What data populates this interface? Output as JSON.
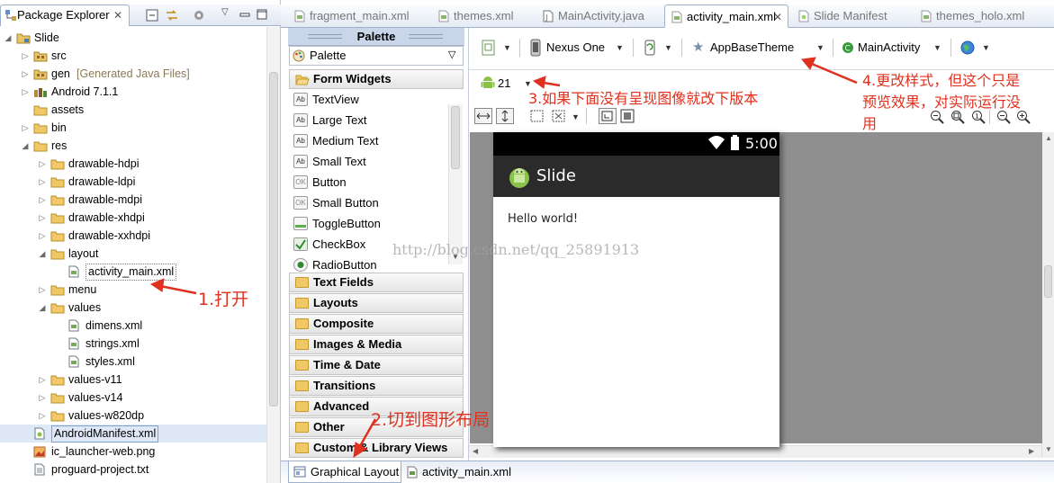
{
  "package_explorer": {
    "tab_label": "Package Explorer",
    "tree": [
      {
        "label": "Slide",
        "icon": "project-icon"
      },
      {
        "label": "src",
        "icon": "package-folder-icon"
      },
      {
        "label": "gen",
        "extra": "[Generated Java Files]",
        "icon": "package-folder-icon"
      },
      {
        "label": "Android 7.1.1",
        "icon": "library-icon"
      },
      {
        "label": "assets",
        "icon": "folder-icon"
      },
      {
        "label": "bin",
        "icon": "folder-icon"
      },
      {
        "label": "res",
        "icon": "folder-icon"
      },
      {
        "label": "drawable-hdpi",
        "icon": "folder-icon"
      },
      {
        "label": "drawable-ldpi",
        "icon": "folder-icon"
      },
      {
        "label": "drawable-mdpi",
        "icon": "folder-icon"
      },
      {
        "label": "drawable-xhdpi",
        "icon": "folder-icon"
      },
      {
        "label": "drawable-xxhdpi",
        "icon": "folder-icon"
      },
      {
        "label": "layout",
        "icon": "folder-icon"
      },
      {
        "label": "activity_main.xml",
        "icon": "xml-file-icon"
      },
      {
        "label": "menu",
        "icon": "folder-icon"
      },
      {
        "label": "values",
        "icon": "folder-icon"
      },
      {
        "label": "dimens.xml",
        "icon": "xml-file-icon"
      },
      {
        "label": "strings.xml",
        "icon": "xml-file-icon"
      },
      {
        "label": "styles.xml",
        "icon": "xml-file-icon"
      },
      {
        "label": "values-v11",
        "icon": "folder-icon"
      },
      {
        "label": "values-v14",
        "icon": "folder-icon"
      },
      {
        "label": "values-w820dp",
        "icon": "folder-icon"
      },
      {
        "label": "AndroidManifest.xml",
        "icon": "manifest-icon"
      },
      {
        "label": "ic_launcher-web.png",
        "icon": "image-file-icon"
      },
      {
        "label": "proguard-project.txt",
        "icon": "text-file-icon"
      }
    ]
  },
  "editor_tabs": [
    {
      "label": "fragment_main.xml",
      "icon": "xml-file-icon"
    },
    {
      "label": "themes.xml",
      "icon": "xml-file-icon"
    },
    {
      "label": "MainActivity.java",
      "icon": "java-file-icon"
    },
    {
      "label": "activity_main.xml",
      "icon": "xml-file-icon",
      "active": true
    },
    {
      "label": "Slide Manifest",
      "icon": "manifest-icon"
    },
    {
      "label": "themes_holo.xml",
      "icon": "xml-file-icon"
    }
  ],
  "palette": {
    "title": "Palette",
    "dropdown": "Palette",
    "open_category": "Form Widgets",
    "widgets": [
      {
        "label": "TextView",
        "icon": "Ab"
      },
      {
        "label": "Large Text",
        "icon": "Ab"
      },
      {
        "label": "Medium Text",
        "icon": "Ab"
      },
      {
        "label": "Small Text",
        "icon": "Ab"
      },
      {
        "label": "Button",
        "icon": "OK"
      },
      {
        "label": "Small Button",
        "icon": "OK"
      },
      {
        "label": "ToggleButton",
        "icon": "toggle"
      },
      {
        "label": "CheckBox",
        "icon": "check"
      },
      {
        "label": "RadioButton",
        "icon": "radio"
      }
    ],
    "categories": [
      "Text Fields",
      "Layouts",
      "Composite",
      "Images & Media",
      "Time & Date",
      "Transitions",
      "Advanced",
      "Other",
      "Custom & Library Views"
    ]
  },
  "toolbar": {
    "device": "Nexus One",
    "theme": "AppBaseTheme",
    "activity": "MainActivity",
    "api_level": "21"
  },
  "device_preview": {
    "time": "5:00",
    "app_title": "Slide",
    "content_text": "Hello world!"
  },
  "bottom_tabs": {
    "graphical": "Graphical Layout",
    "xml": "activity_main.xml"
  },
  "annotations": {
    "note1": "1.打开",
    "note2": "2.切到图形布局",
    "note3": "3.如果下面没有呈现图像就改下版本",
    "note4_line1": "4.更改样式，但这个只是",
    "note4_line2": "预览效果，对实际运行没",
    "note4_line3": "用"
  },
  "watermark": "http://blog.csdn.net/qq_25891913",
  "colors": {
    "annotation_red": "#e0301e",
    "action_bar": "#2b2b2b",
    "status_bar": "#000000",
    "canvas_gray": "#8f8f8f"
  }
}
